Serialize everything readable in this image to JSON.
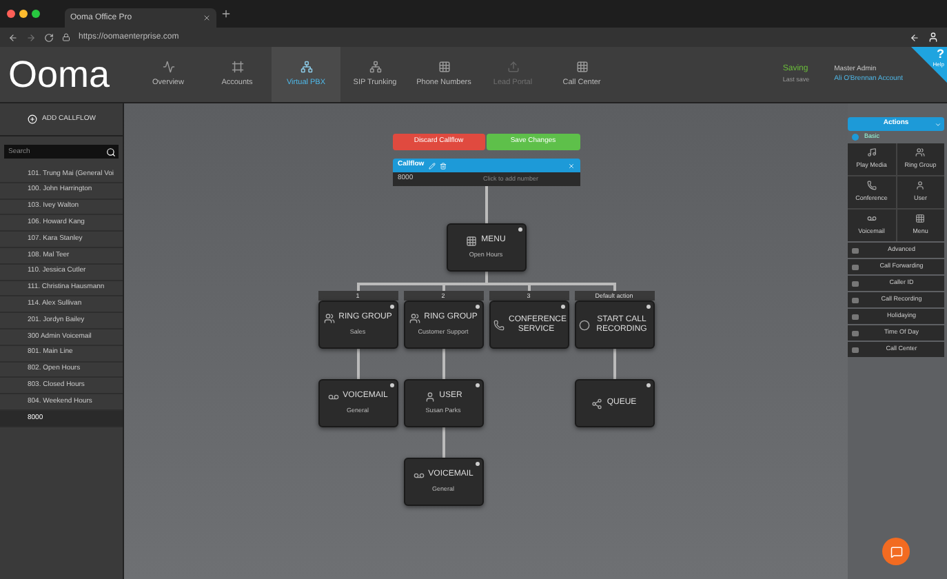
{
  "browser": {
    "tab_title": "Ooma Office Pro",
    "url": "https://oomaenterprise.com"
  },
  "header": {
    "logo": "Ooma",
    "nav": [
      {
        "label": "Overview",
        "selected": false,
        "disabled": false
      },
      {
        "label": "Accounts",
        "selected": false,
        "disabled": false
      },
      {
        "label": "Virtual PBX",
        "selected": true,
        "disabled": false
      },
      {
        "label": "SIP Trunking",
        "selected": false,
        "disabled": false
      },
      {
        "label": "Phone Numbers",
        "selected": false,
        "disabled": false
      },
      {
        "label": "Lead Portal",
        "selected": false,
        "disabled": true
      },
      {
        "label": "Call Center",
        "selected": false,
        "disabled": false
      }
    ],
    "status": "Saving",
    "status_detail": "Last save",
    "user_role": "Master Admin",
    "user_account": "Ali O'Brennan Account",
    "help": "?",
    "help_label": "Help"
  },
  "sidebar": {
    "add_button": "ADD CALLFLOW",
    "search": {
      "placeholder": "Search"
    },
    "items": [
      {
        "label": "101. Trung Mai (General Voi",
        "selected": false
      },
      {
        "label": "100. John Harrington",
        "selected": false
      },
      {
        "label": "103. Ivey Walton",
        "selected": false
      },
      {
        "label": "106. Howard Kang",
        "selected": false
      },
      {
        "label": "107. Kara Stanley",
        "selected": false
      },
      {
        "label": "108. Mal Teer",
        "selected": false
      },
      {
        "label": "110. Jessica Cutler",
        "selected": false
      },
      {
        "label": "111. Christina Hausmann",
        "selected": false
      },
      {
        "label": "114. Alex Sullivan",
        "selected": false
      },
      {
        "label": "201. Jordyn Bailey",
        "selected": false
      },
      {
        "label": "300 Admin Voicemail",
        "selected": false
      },
      {
        "label": "801. Main Line",
        "selected": false
      },
      {
        "label": "802. Open Hours",
        "selected": false
      },
      {
        "label": "803. Closed Hours",
        "selected": false
      },
      {
        "label": "804. Weekend Hours",
        "selected": false
      },
      {
        "label": "8000",
        "selected": true
      }
    ]
  },
  "editor": {
    "discard": "Discard Callflow",
    "save": "Save Changes",
    "callflow_title": "Callflow",
    "number": "8000",
    "add_number": "Click to add number",
    "root": {
      "kind": "menu",
      "title": "MENU",
      "subtitle": "Open Hours",
      "branches": [
        {
          "label": "1",
          "node": {
            "kind": "ring_group",
            "title": "RING GROUP",
            "subtitle": "Sales",
            "children": [
              {
                "kind": "voicemail",
                "title": "VOICEMAIL",
                "subtitle": "General"
              }
            ]
          }
        },
        {
          "label": "2",
          "node": {
            "kind": "ring_group",
            "title": "RING GROUP",
            "subtitle": "Customer Support",
            "children": [
              {
                "kind": "user",
                "title": "USER",
                "subtitle": "Susan Parks",
                "children": [
                  {
                    "kind": "voicemail",
                    "title": "VOICEMAIL",
                    "subtitle": "General"
                  }
                ]
              }
            ]
          }
        },
        {
          "label": "3",
          "node": {
            "kind": "conference",
            "title": "CONFERENCE SERVICE"
          }
        },
        {
          "label": "Default action",
          "node": {
            "kind": "recording",
            "title": "START CALL RECORDING",
            "children": [
              {
                "kind": "queue",
                "title": "QUEUE"
              }
            ]
          }
        }
      ]
    }
  },
  "actions": {
    "title": "Actions",
    "section": "Basic",
    "tiles": [
      "Play Media",
      "Ring Group",
      "Conference",
      "User",
      "Voicemail",
      "Menu"
    ],
    "groups": [
      "Advanced",
      "Call Forwarding",
      "Caller ID",
      "Call Recording",
      "Holidaying",
      "Time Of Day",
      "Call Center"
    ]
  }
}
